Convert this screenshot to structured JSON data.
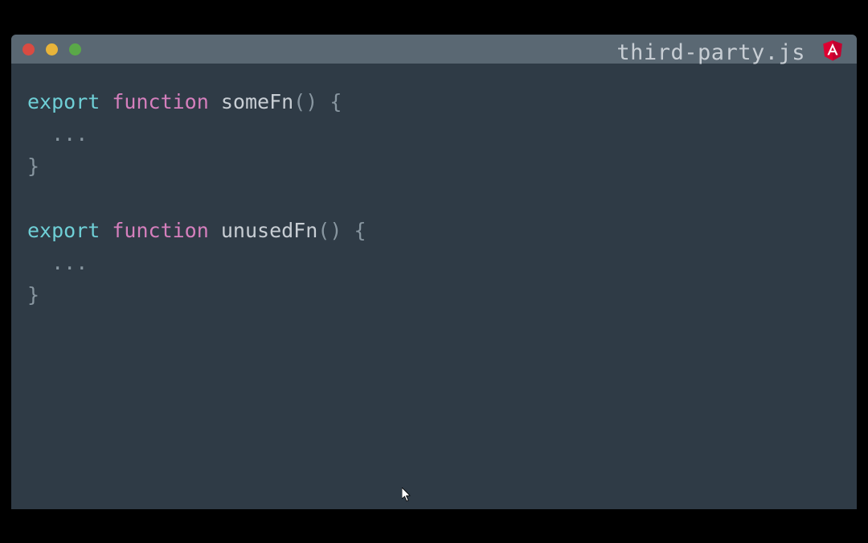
{
  "window": {
    "title": "third-party.js"
  },
  "code": {
    "linesA": {
      "export": "export",
      "function": "function",
      "name": "someFn",
      "parens": "()",
      "openBrace": "{",
      "body": "  ...",
      "closeBrace": "}"
    },
    "linesB": {
      "export": "export",
      "function": "function",
      "name": "unusedFn",
      "parens": "()",
      "openBrace": "{",
      "body": "  ...",
      "closeBrace": "}"
    }
  },
  "icons": {
    "angular": "angular-icon"
  }
}
